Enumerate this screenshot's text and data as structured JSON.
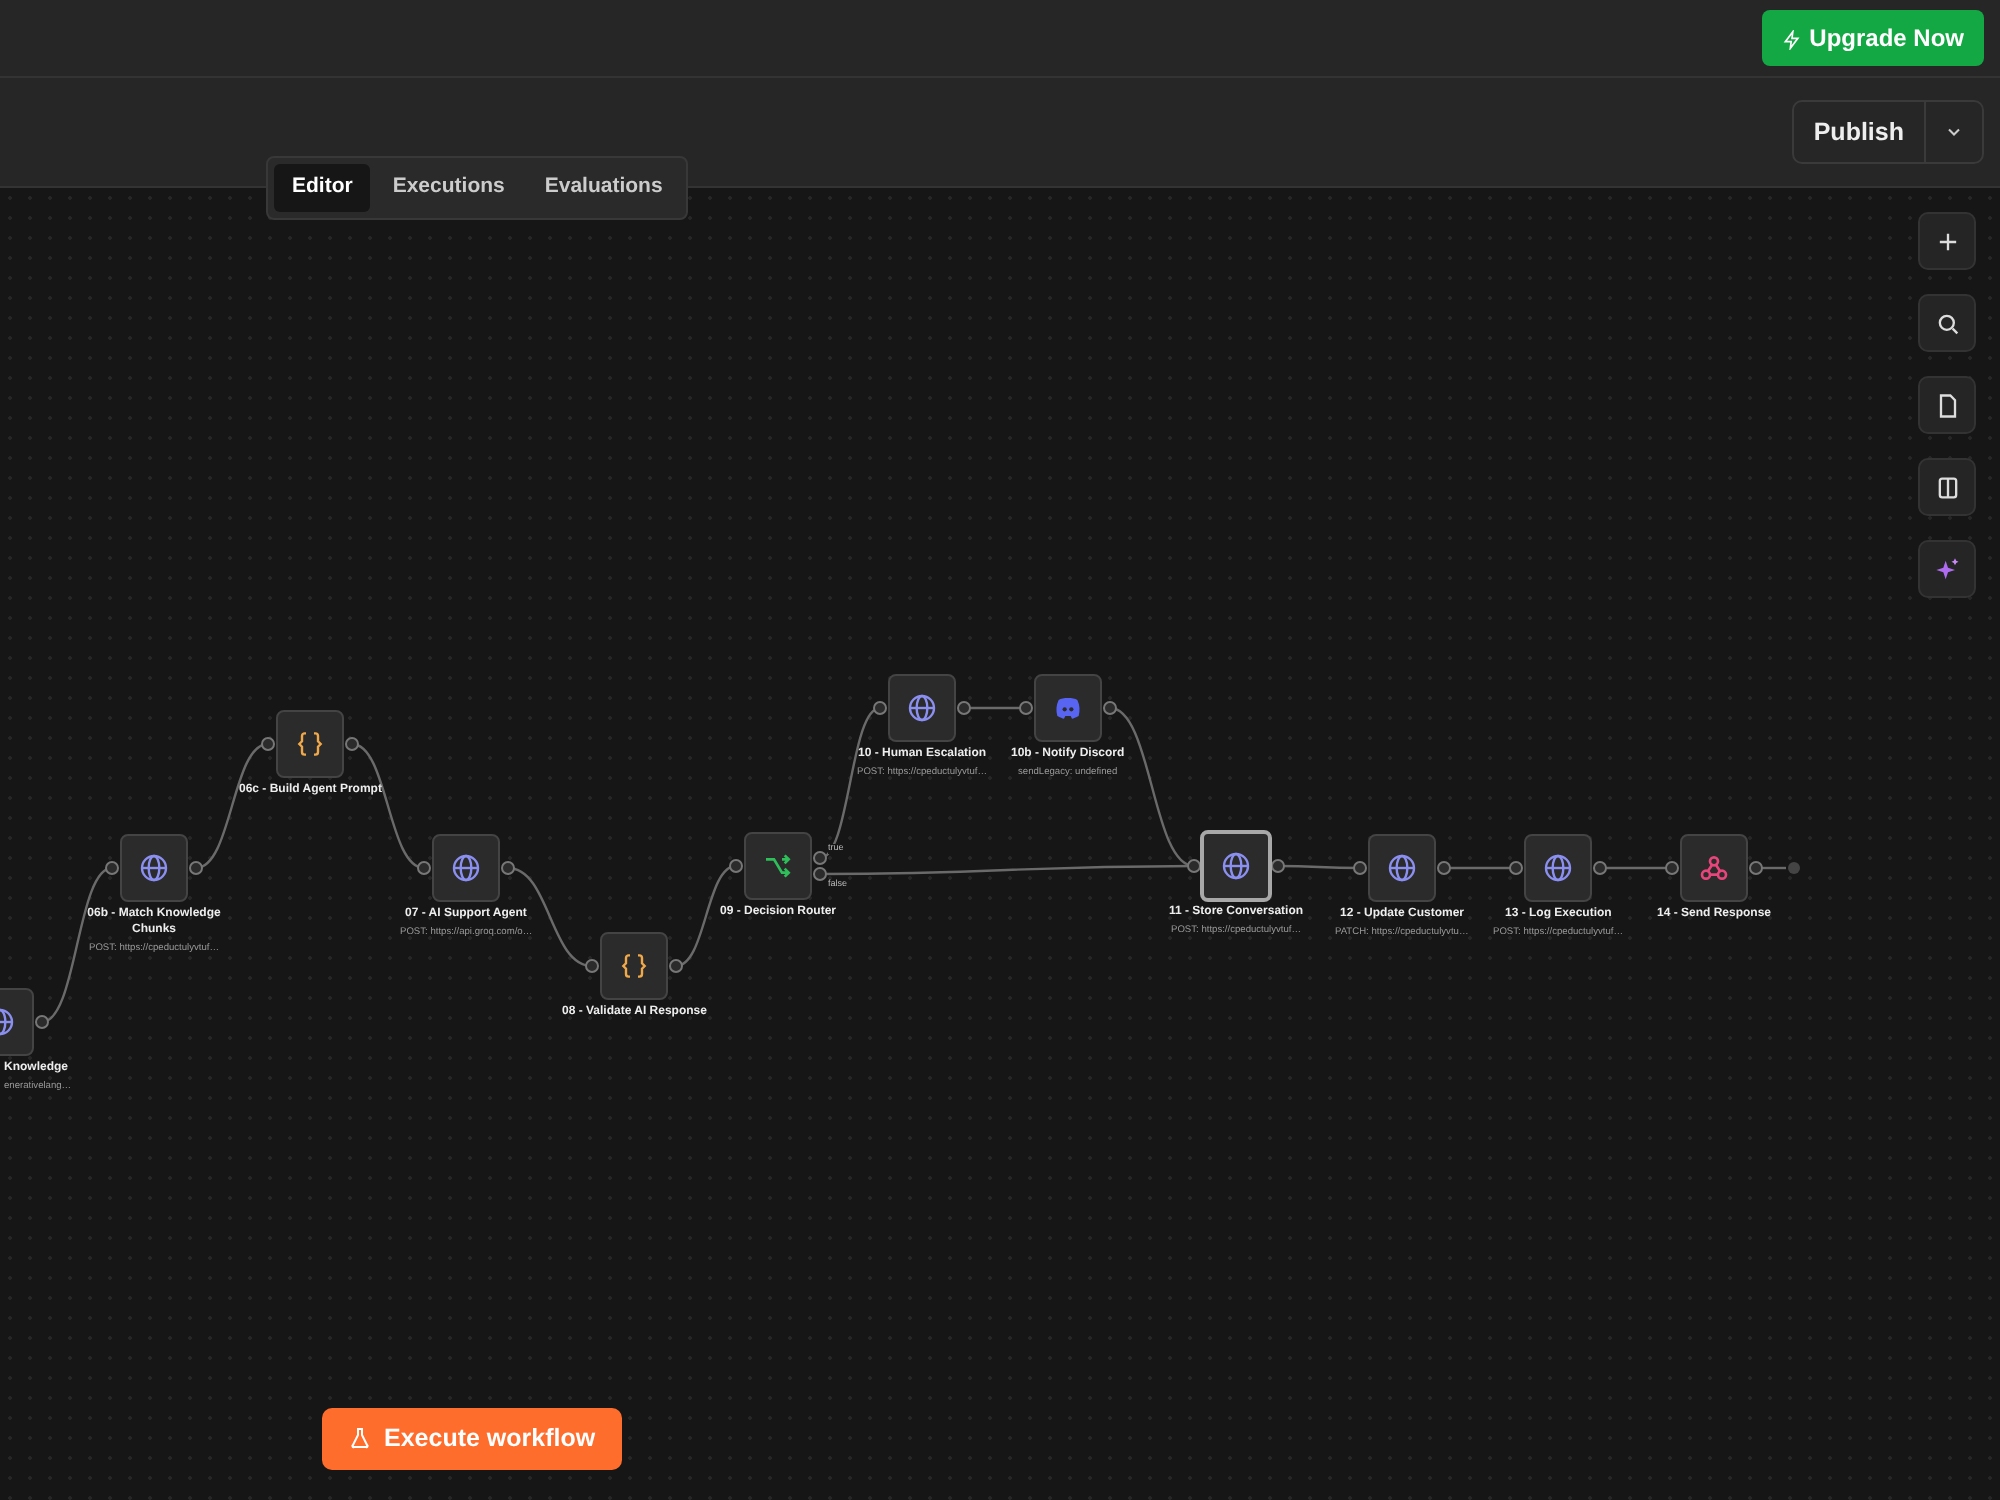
{
  "top_bar": {
    "upgrade_button": "Upgrade Now"
  },
  "header": {
    "publish_button": "Publish"
  },
  "tabs": [
    {
      "label": "Editor",
      "selected": true
    },
    {
      "label": "Executions",
      "selected": false
    },
    {
      "label": "Evaluations",
      "selected": false
    }
  ],
  "canvas_tools": [
    {
      "kind": "add"
    },
    {
      "kind": "search"
    },
    {
      "kind": "note"
    },
    {
      "kind": "panel"
    },
    {
      "kind": "ai"
    }
  ],
  "nodes": [
    {
      "kind": "http",
      "title": "Knowledge",
      "subtitle": "enerativelang…",
      "selected": false
    },
    {
      "kind": "http",
      "title": "06b - Match Knowledge Chunks",
      "subtitle": "POST: https://cpeductulyvtuf…",
      "selected": false
    },
    {
      "kind": "code",
      "title": "06c - Build Agent Prompt",
      "selected": false
    },
    {
      "kind": "http",
      "title": "07 - AI Support Agent",
      "subtitle": "POST: https://api.groq.com/o…",
      "selected": false
    },
    {
      "kind": "code",
      "title": "08 - Validate AI Response",
      "selected": false
    },
    {
      "kind": "router",
      "title": "09 - Decision Router",
      "outputs": [
        "true",
        "false"
      ],
      "selected": false
    },
    {
      "kind": "http",
      "title": "10 - Human Escalation",
      "subtitle": "POST: https://cpeductulyvtuf…",
      "selected": false
    },
    {
      "kind": "discord",
      "title": "10b - Notify Discord",
      "subtitle": "sendLegacy: undefined",
      "selected": false
    },
    {
      "kind": "http",
      "title": "11 - Store Conversation",
      "subtitle": "POST: https://cpeductulyvtuf…",
      "selected": true
    },
    {
      "kind": "http",
      "title": "12 - Update Customer",
      "subtitle": "PATCH: https://cpeductulyvtu…",
      "selected": false
    },
    {
      "kind": "http",
      "title": "13 - Log Execution",
      "subtitle": "POST: https://cpeductulyvtuf…",
      "selected": false
    },
    {
      "kind": "webhook",
      "title": "14 - Send Response",
      "selected": false
    }
  ],
  "execute_button": "Execute workflow"
}
